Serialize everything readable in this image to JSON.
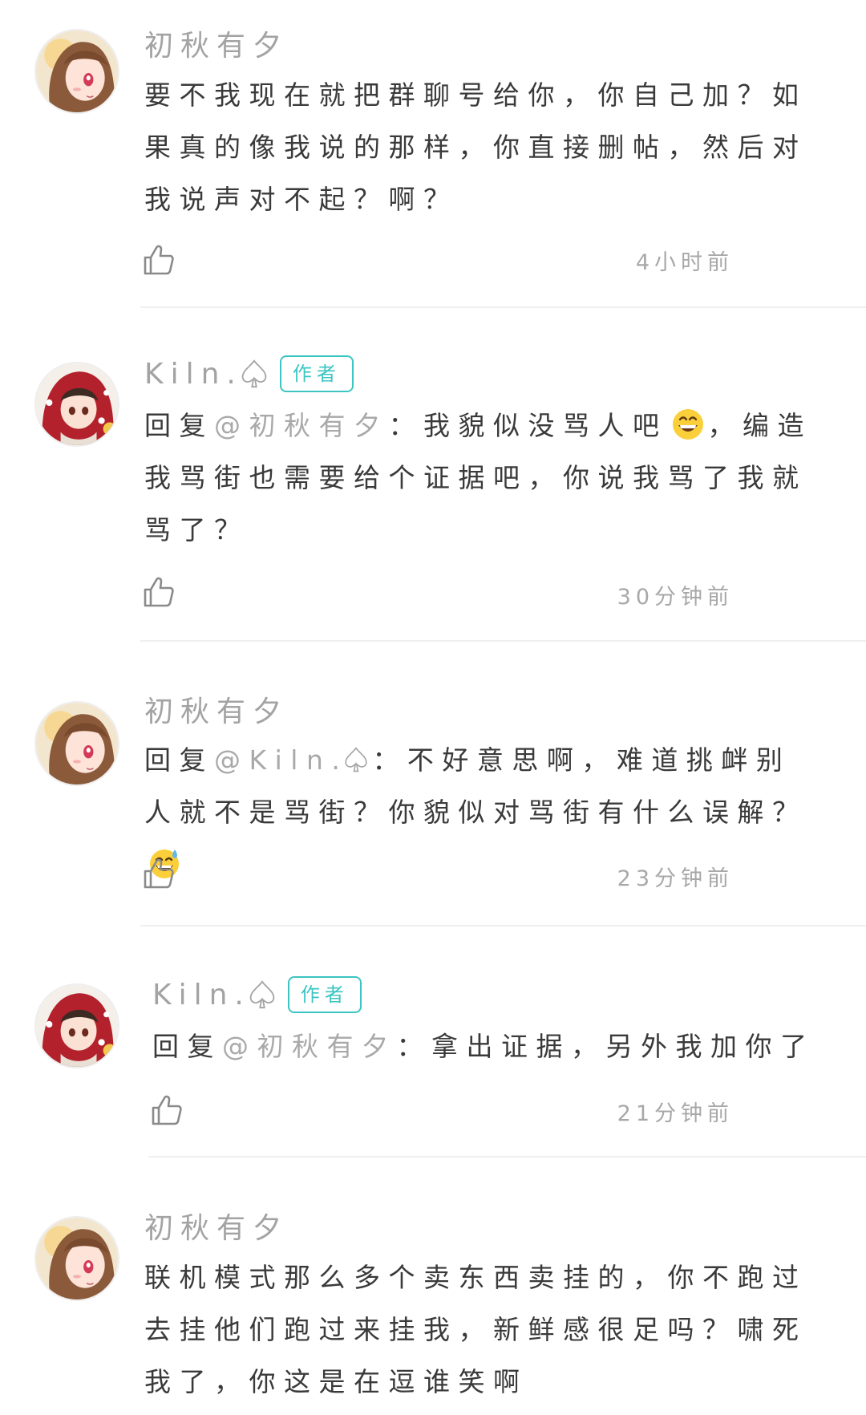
{
  "comments": [
    {
      "username": "初秋有夕",
      "is_author": false,
      "text": "要不我现在就把群聊号给你，你自己加？如果真的像我说的那样，你直接删帖，然后对我说声对不起？啊？",
      "time": "4小时前",
      "avatar": "girl-avatar"
    },
    {
      "username": "Kiln.",
      "is_author": true,
      "badge": "作者",
      "reply_prefix": "回复",
      "mention": "@初秋有夕",
      "colon": "：",
      "text_a": "我貌似没骂人吧",
      "text_b": "，编造我骂街也需要给个证据吧，你说我骂了我就骂了？",
      "emoji": "grinning-face-emoji",
      "time": "30分钟前",
      "avatar": "red-hood-avatar"
    },
    {
      "username": "初秋有夕",
      "is_author": false,
      "reply_prefix": "回复",
      "mention": "@Kiln.",
      "colon": "：",
      "text_a": "不好意思啊，难道挑衅别人就不是骂街？你貌似对骂街有什么误解？",
      "emoji": "grinning-sweat-emoji",
      "time": "23分钟前",
      "avatar": "girl-avatar"
    },
    {
      "username": "Kiln.",
      "is_author": true,
      "badge": "作者",
      "reply_prefix": "回复",
      "mention": "@初秋有夕",
      "colon": "：",
      "text_a": "拿出证据，另外我加你了",
      "time": "21分钟前",
      "avatar": "red-hood-avatar"
    },
    {
      "username": "初秋有夕",
      "is_author": false,
      "text": "联机模式那么多个卖东西卖挂的，你不跑过去挂他们跑过来挂我，新鲜感很足吗？啸死我了，你这是在逗谁笑啊",
      "avatar": "girl-avatar"
    }
  ],
  "colors": {
    "accent": "#3cc5c3",
    "name": "#a3a3a3",
    "body": "#3a3a3a",
    "time": "#a8a8a8"
  }
}
